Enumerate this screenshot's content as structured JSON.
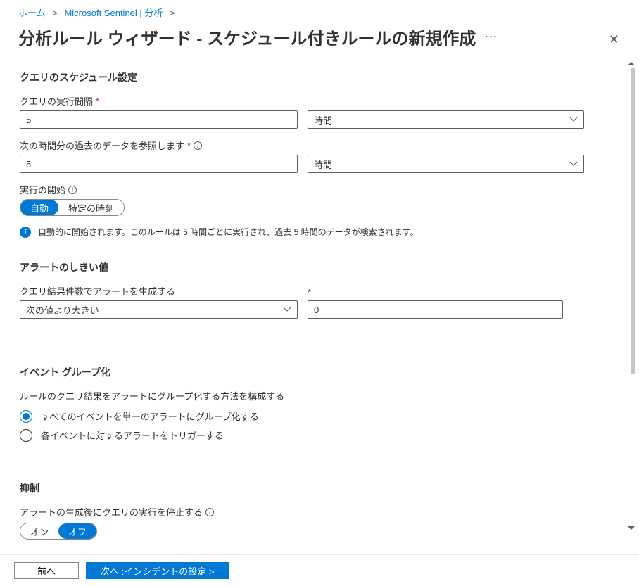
{
  "breadcrumb": {
    "home": "ホーム",
    "sentinel": "Microsoft Sentinel | 分析"
  },
  "page_title": "分析ルール ウィザード - スケジュール付きルールの新規作成",
  "sections": {
    "schedule": {
      "title": "クエリのスケジュール設定",
      "interval_label": "クエリの実行間隔",
      "interval_value": "5",
      "interval_unit": "時間",
      "lookback_label": "次の時間分の過去のデータを参照します",
      "lookback_value": "5",
      "lookback_unit": "時間",
      "run_start_label": "実行の開始",
      "run_start_options": {
        "auto": "自動",
        "specific": "特定の時刻"
      },
      "info_text": "自動的に開始されます。このルールは 5 時間ごとに実行され、過去 5 時間のデータが検索されます。"
    },
    "threshold": {
      "title": "アラートのしきい値",
      "label": "クエリ結果件数でアラートを生成する",
      "operator": "次の値より大きい",
      "value": "0"
    },
    "grouping": {
      "title": "イベント グループ化",
      "label": "ルールのクエリ結果をアラートにグループ化する方法を構成する",
      "options": {
        "single": "すべてのイベントを単一のアラートにグループ化する",
        "each": "各イベントに対するアラートをトリガーする"
      }
    },
    "suppression": {
      "title": "抑制",
      "label": "アラートの生成後にクエリの実行を停止する",
      "on": "オン",
      "off": "オフ"
    }
  },
  "footer": {
    "prev": "前へ",
    "next": "次へ :インシデントの設定  >"
  }
}
